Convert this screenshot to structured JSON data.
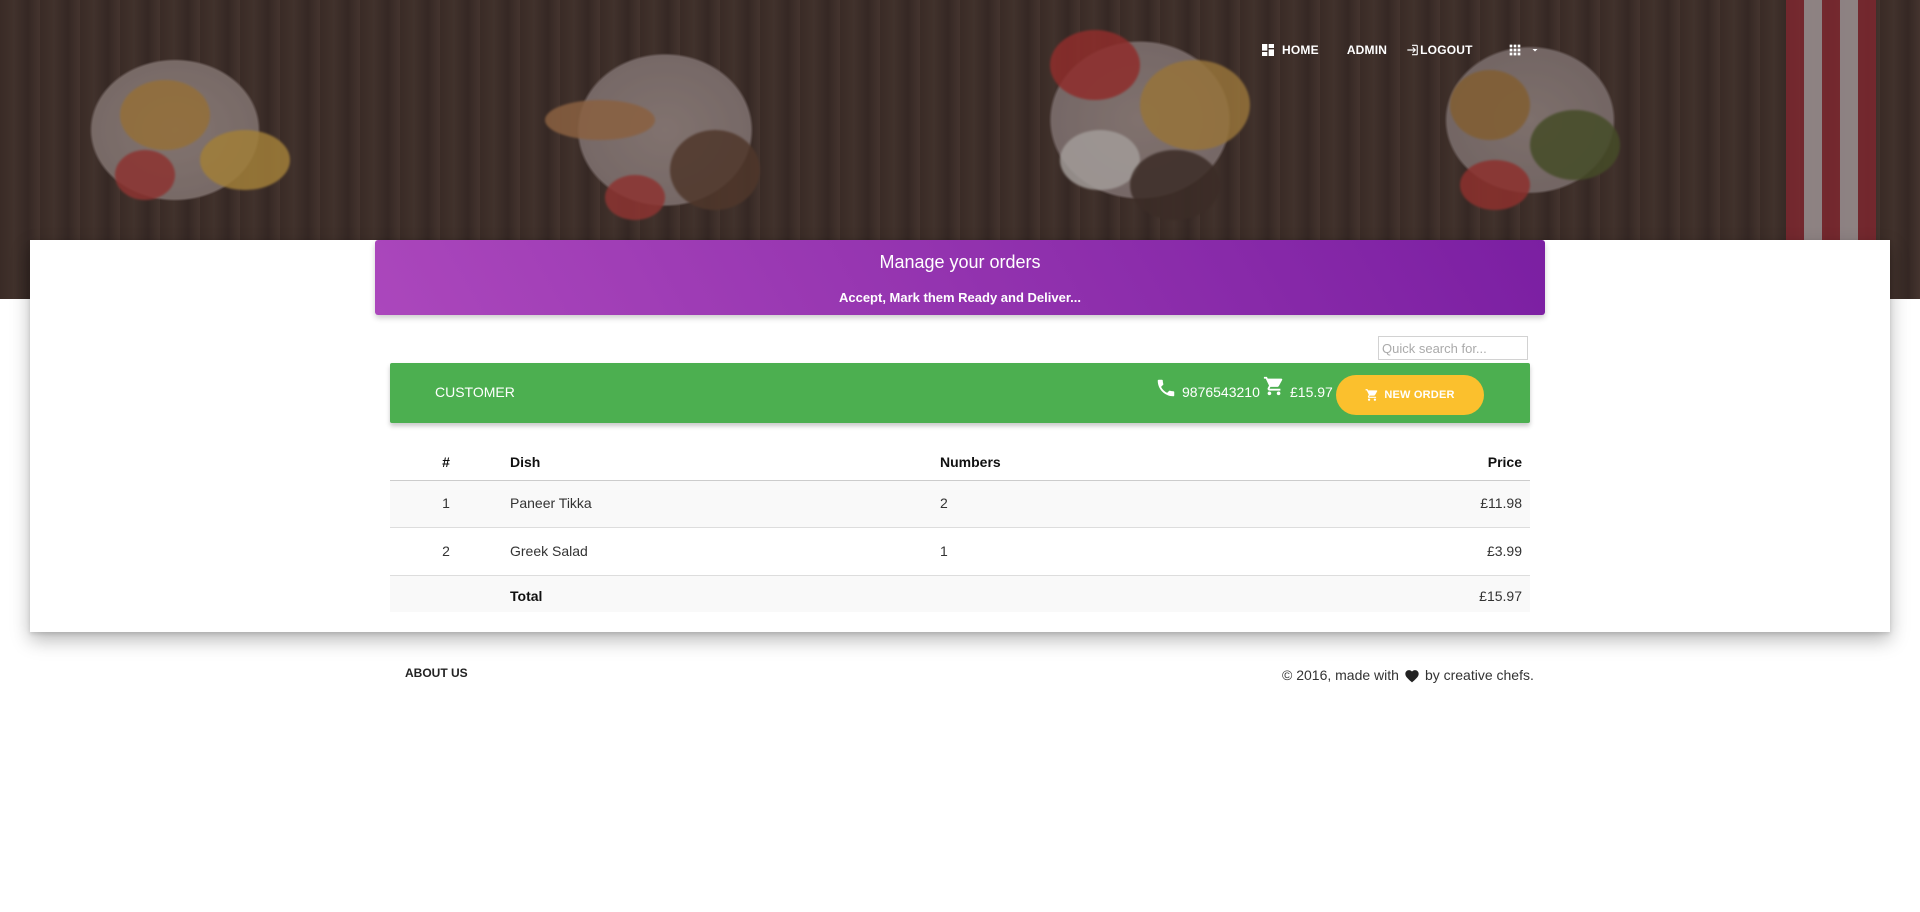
{
  "nav": {
    "home_label": "HOME",
    "admin_label": "ADMIN",
    "logout_label": "LOGOUT"
  },
  "banner": {
    "title": "Manage your orders",
    "subtitle": "Accept, Mark them Ready and Deliver..."
  },
  "search": {
    "placeholder": "Quick search for..."
  },
  "customer": {
    "name": "CUSTOMER",
    "phone": "9876543210",
    "cart_total": "£15.97",
    "new_order_label": "NEW ORDER"
  },
  "table": {
    "headers": {
      "num": "#",
      "dish": "Dish",
      "numbers": "Numbers",
      "price": "Price"
    },
    "rows": [
      {
        "num": "1",
        "dish": "Paneer Tikka",
        "numbers": "2",
        "price": "£11.98"
      },
      {
        "num": "2",
        "dish": "Greek Salad",
        "numbers": "1",
        "price": "£3.99"
      }
    ],
    "total": {
      "label": "Total",
      "price": "£15.97"
    }
  },
  "footer": {
    "about_label": "ABOUT US",
    "credit_before": "© 2016, made with",
    "credit_after": "by creative chefs."
  },
  "colors": {
    "banner_start": "#ab47bc",
    "banner_end": "#7b1fa2",
    "customer_bar": "#4caf50",
    "new_order_button": "#fbc02d"
  },
  "icons": {
    "home": "dashboard-icon",
    "logout": "login-icon",
    "apps": "apps-grid-icon",
    "phone": "phone-icon",
    "cart": "cart-icon",
    "heart": "heart-icon"
  }
}
